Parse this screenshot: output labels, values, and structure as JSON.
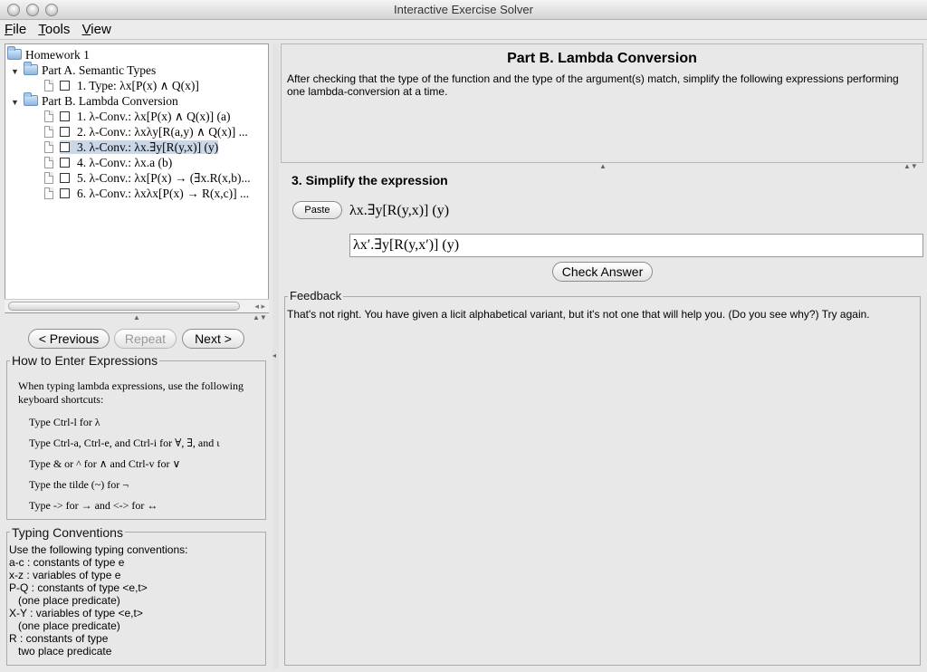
{
  "window": {
    "title": "Interactive Exercise Solver"
  },
  "menu": [
    "File",
    "Tools",
    "View"
  ],
  "tree": {
    "root": "Homework 1",
    "partA": {
      "label": "Part A. Semantic Types",
      "items": [
        "1. Type: λx[P(x) ∧ Q(x)]"
      ]
    },
    "partB": {
      "label": "Part B. Lambda Conversion",
      "items": [
        "1. λ-Conv.: λx[P(x) ∧ Q(x)] (a)",
        "2. λ-Conv.: λxλy[R(a,y) ∧ Q(x)] ...",
        "3. λ-Conv.: λx.∃y[R(y,x)] (y)",
        "4. λ-Conv.: λx.a (b)",
        "5. λ-Conv.: λx[P(x) → (∃x.R(x,b)...",
        "6. λ-Conv.: λxλx[P(x) → R(x,c)] ..."
      ],
      "selected_index": 2
    }
  },
  "nav": {
    "previous": "< Previous",
    "repeat": "Repeat",
    "next": "Next >"
  },
  "help": {
    "title": "How to Enter Expressions",
    "intro1": "When typing lambda expressions, use the following",
    "intro2": "keyboard shortcuts:",
    "lines": [
      "Type Ctrl-l for λ",
      "Type Ctrl-a, Ctrl-e, and Ctrl-i for ∀, ∃, and ι",
      "Type & or ^ for ∧ and Ctrl-v for ∨",
      "Type the tilde (~) for ¬",
      "Type -> for → and <-> for ↔"
    ]
  },
  "conventions": {
    "title": "Typing Conventions",
    "lines": [
      "Use the following typing conventions:",
      "a-c : constants of type e",
      "x-z : variables of type e",
      "P-Q : constants of type <e,t>",
      "   (one place predicate)",
      "X-Y : variables of type <e,t>",
      "   (one place predicate)",
      "R : constants of type",
      "   two place predicate"
    ]
  },
  "part": {
    "title": "Part B. Lambda Conversion",
    "description_line1": "After checking that the type of the function and the type of the argument(s) match, simplify the following expressions performing",
    "description_line2": "one lambda-conversion at a time."
  },
  "exercise": {
    "heading": "3. Simplify the expression",
    "paste_label": "Paste",
    "expression": "λx.∃y[R(y,x)] (y)",
    "answer_value": "λx′.∃y[R(y,x′)] (y)",
    "check_label": "Check Answer"
  },
  "feedback": {
    "title": "Feedback",
    "text": "That's not right.  You have given a licit alphabetical variant, but it's not one that will help you.  (Do you see why?)  Try again."
  }
}
